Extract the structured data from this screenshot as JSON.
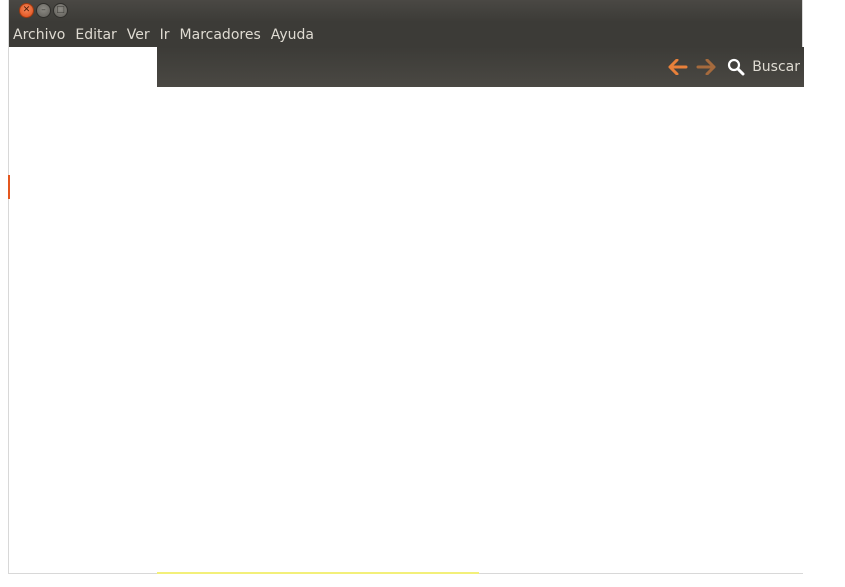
{
  "window": {
    "controls": {
      "close_icon": "close-icon",
      "minimize_icon": "minimize-icon",
      "maximize_icon": "maximize-icon"
    }
  },
  "menubar": {
    "items": [
      {
        "label": "Archivo"
      },
      {
        "label": "Editar"
      },
      {
        "label": "Ver"
      },
      {
        "label": "Ir"
      },
      {
        "label": "Marcadores"
      },
      {
        "label": "Ayuda"
      }
    ]
  },
  "toolbar": {
    "back_icon": "arrow-left-icon",
    "forward_icon": "arrow-right-icon",
    "search_icon": "search-icon",
    "search_label": "Buscar"
  },
  "colors": {
    "titlebar": "#3c3b37",
    "close_button": "#df4a16",
    "back_arrow": "#e8803a",
    "forward_arrow": "#a56a3d",
    "menu_text": "#dfdbd2",
    "sidebar_marker": "#e4571f"
  }
}
